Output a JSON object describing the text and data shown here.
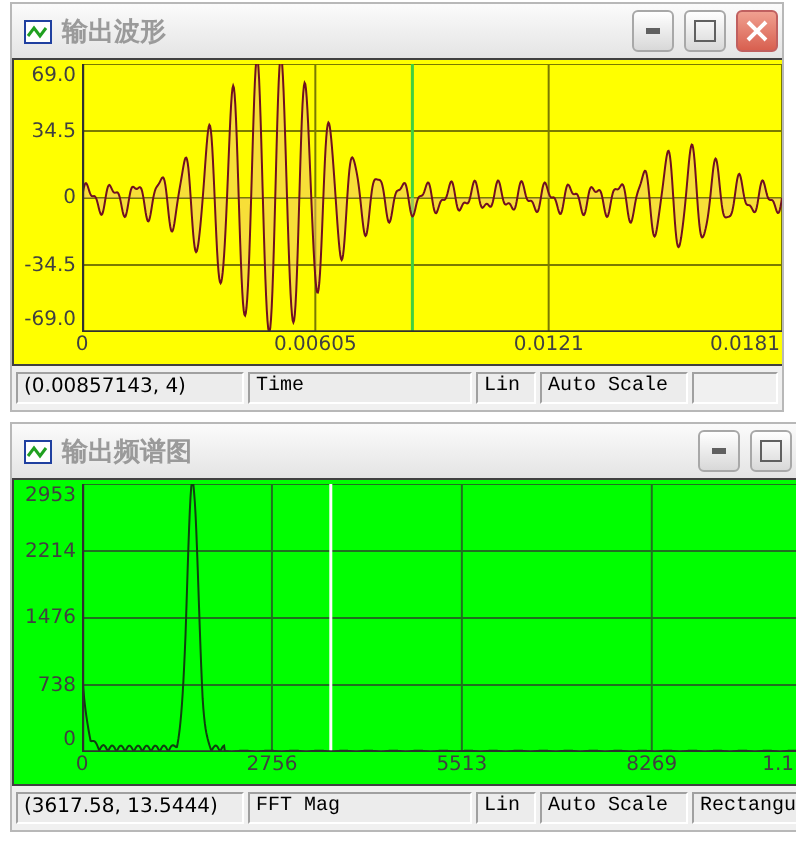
{
  "windows": [
    {
      "title": "输出波形",
      "kind": "time",
      "color": "#ffff00",
      "y_ticks": [
        "69.0",
        "34.5",
        "0",
        "-34.5",
        "-69.0"
      ],
      "x_ticks": [
        "0",
        "0.00605",
        "0.0121",
        "0.0181"
      ],
      "status": [
        "(0.00857143, 4)",
        "Time",
        "Lin",
        "Auto Scale"
      ]
    },
    {
      "title": "输出频谱图",
      "kind": "spectrum",
      "color": "#00ff00",
      "y_ticks": [
        "2953",
        "2214",
        "1476",
        "738",
        "0"
      ],
      "x_ticks": [
        "0",
        "2756",
        "5513",
        "8269",
        "1.1"
      ],
      "status": [
        "(3617.58, 13.5444)",
        "FFT Mag",
        "Lin",
        "Auto Scale",
        "Rectangu"
      ]
    }
  ]
}
